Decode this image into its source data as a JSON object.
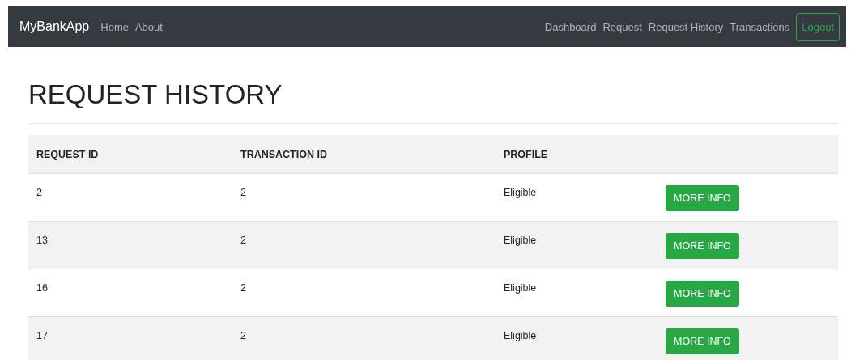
{
  "navbar": {
    "brand": "MyBankApp",
    "left_links": [
      "Home",
      "About"
    ],
    "right_links": [
      "Dashboard",
      "Request",
      "Request History",
      "Transactions"
    ],
    "logout": "Logout"
  },
  "heading": "REQUEST HISTORY",
  "table": {
    "columns": [
      "REQUEST ID",
      "TRANSACTION ID",
      "PROFILE"
    ],
    "rows": [
      {
        "request_id": "2",
        "transaction_id": "2",
        "profile": "Eligible",
        "action": "MORE INFO"
      },
      {
        "request_id": "13",
        "transaction_id": "2",
        "profile": "Eligible",
        "action": "MORE INFO"
      },
      {
        "request_id": "16",
        "transaction_id": "2",
        "profile": "Eligible",
        "action": "MORE INFO"
      },
      {
        "request_id": "17",
        "transaction_id": "2",
        "profile": "Eligible",
        "action": "MORE INFO"
      }
    ]
  }
}
